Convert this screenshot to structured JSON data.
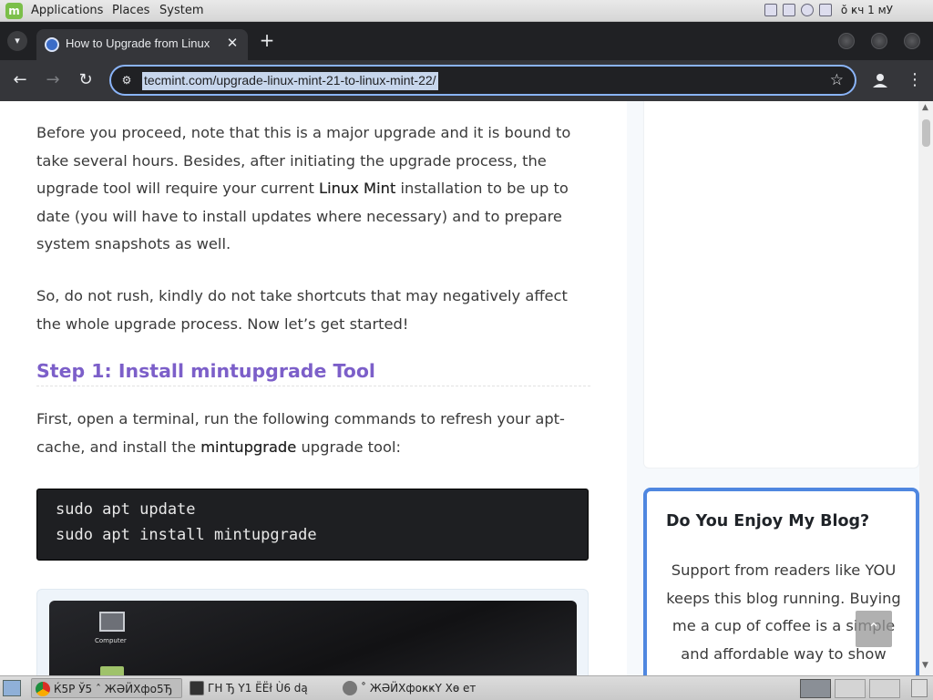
{
  "system_panel": {
    "menus": [
      "Applications",
      "Places",
      "System"
    ],
    "clock": "ŏ ҝч 1 мУ"
  },
  "browser": {
    "tab_title": "How to Upgrade from Linux",
    "tab_menu_icon": "chevron-down-icon",
    "tab_close_icon": "close-icon",
    "new_tab_icon": "plus-icon",
    "url": "tecmint.com/upgrade-linux-mint-21-to-linux-mint-22/",
    "accent_color": "#8ab4f8"
  },
  "article": {
    "para1_parts": [
      "Before you proceed, note that this is a major upgrade and it is bound to take several hours. Besides, after initiating the upgrade process, the upgrade tool will require your current ",
      "Linux Mint",
      " installation to be up to date (you will have to install updates where necessary) and to prepare system snapshots as well."
    ],
    "para2": "So, do not rush, kindly do not take shortcuts that may negatively affect the whole upgrade process. Now let’s get started!",
    "step_heading": "Step 1: Install mintupgrade Tool",
    "step_heading_color": "#7c5fc9",
    "para3_parts": [
      "First, open a terminal, run the following commands to refresh your apt-cache, and install the ",
      "mintupgrade",
      " upgrade tool:"
    ],
    "code_lines": [
      "sudo apt update",
      "sudo apt install mintupgrade"
    ],
    "screenshot_label": "Computer"
  },
  "sidebar": {
    "support_title": "Do You Enjoy My Blog?",
    "support_text": "Support from readers like YOU keeps this blog running. Buying me a cup of coffee is a simple and affordable way to show",
    "support_border_color": "#4f87e0"
  },
  "taskbar": {
    "tasks": [
      "Ќ5Р Ў5 ˆ ЖӘӤХфо5Ђ",
      "ГН   Ђ Ү1 ЁЁł Ù6 dą",
      "˚ ЖӘӤХфоҝҝҮ Хө ет"
    ]
  }
}
